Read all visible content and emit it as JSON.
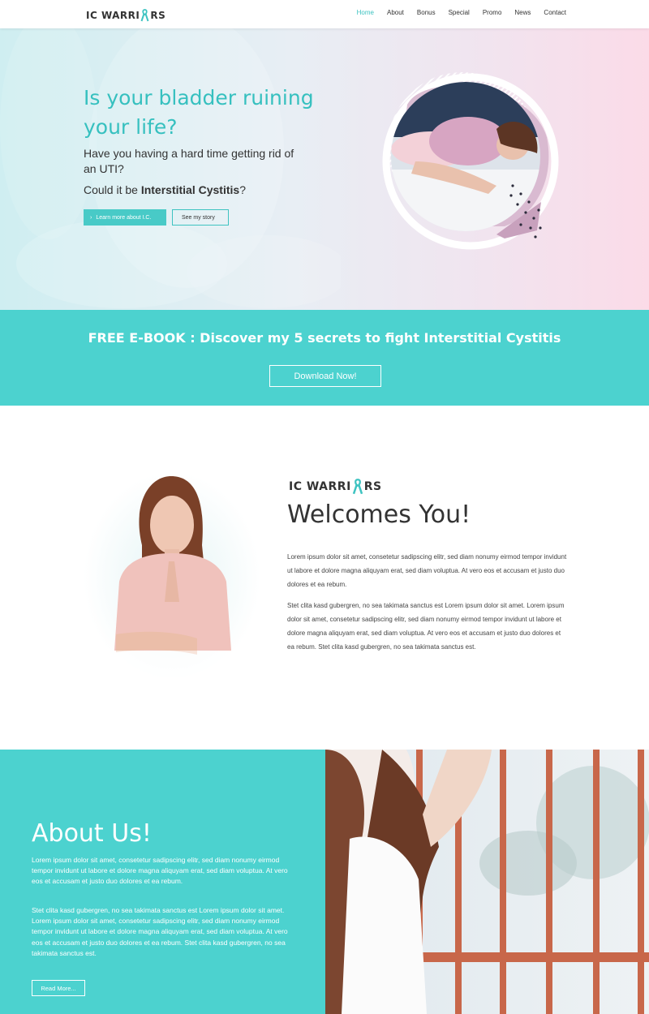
{
  "nav": {
    "logo_text": "IC WARRI RS",
    "items": [
      {
        "label": "Home",
        "active": true
      },
      {
        "label": "About",
        "active": false
      },
      {
        "label": "Bonus",
        "active": false
      },
      {
        "label": "Special",
        "active": false
      },
      {
        "label": "Promo",
        "active": false
      },
      {
        "label": "News",
        "active": false
      },
      {
        "label": "Contact",
        "active": false
      }
    ]
  },
  "hero": {
    "title": "Is your bladder ruining your life?",
    "subtitle": "Have you having a hard time getting rid of an UTI?",
    "question_prefix": "Could it be ",
    "question_bold": "Interstitial Cystitis",
    "question_suffix": "?",
    "primary_button": "Learn more about I.C.",
    "secondary_button": "See my story"
  },
  "ebook": {
    "title": "FREE E-BOOK : Discover my 5 secrets to fight Interstitial Cystitis",
    "button": "Download Now!"
  },
  "welcome": {
    "logo_text": "IC WARRI RS",
    "title": "Welcomes You!",
    "paragraph1": "Lorem ipsum dolor sit amet, consetetur sadipscing elitr, sed diam nonumy eirmod tempor invidunt ut labore et dolore magna aliquyam erat, sed diam voluptua. At vero eos et accusam et justo duo dolores et ea rebum.",
    "paragraph2": "Stet clita kasd gubergren, no sea takimata sanctus est Lorem ipsum dolor sit amet. Lorem ipsum dolor sit amet, consetetur sadipscing elitr, sed diam nonumy eirmod tempor invidunt ut labore et dolore magna aliquyam erat, sed diam voluptua. At vero eos et accusam et justo duo dolores et ea rebum. Stet clita kasd gubergren, no sea takimata sanctus est."
  },
  "about": {
    "title": "About Us!",
    "paragraph1": "Lorem ipsum dolor sit amet, consetetur sadipscing elitr, sed diam nonumy eirmod tempor invidunt ut labore et dolore magna aliquyam erat, sed diam voluptua. At vero eos et accusam et justo duo dolores et ea rebum.",
    "paragraph2": "Stet clita kasd gubergren, no sea takimata sanctus est Lorem ipsum dolor sit amet. Lorem ipsum dolor sit amet, consetetur sadipscing elitr, sed diam nonumy eirmod tempor invidunt ut labore et dolore magna aliquyam erat, sed diam voluptua. At vero eos et accusam et justo duo dolores et ea rebum. Stet clita kasd gubergren, no sea takimata sanctus est.",
    "button": "Read More..."
  },
  "colors": {
    "accent": "#4cd2cf",
    "accent_text": "#36c0bf",
    "ribbon": "#3ec3c1",
    "hero_pink": "#fbdbe8",
    "hero_blue": "#cfeef1"
  },
  "icons": [
    "awareness-ribbon-icon",
    "chevron-right-icon"
  ]
}
